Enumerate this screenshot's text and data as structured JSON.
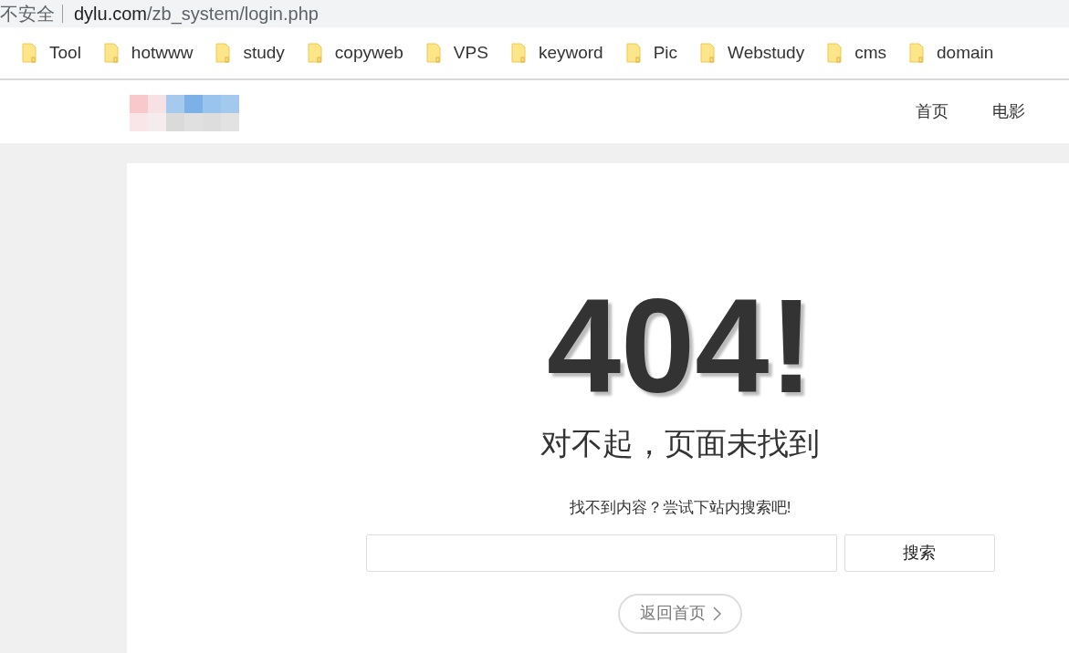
{
  "address_bar": {
    "security": "不安全",
    "url_host": "dylu.com",
    "url_path": "/zb_system/login.php"
  },
  "bookmarks": [
    {
      "label": "Tool"
    },
    {
      "label": "hotwww"
    },
    {
      "label": "study"
    },
    {
      "label": "copyweb"
    },
    {
      "label": "VPS"
    },
    {
      "label": "keyword"
    },
    {
      "label": "Pic"
    },
    {
      "label": "Webstudy"
    },
    {
      "label": "cms"
    },
    {
      "label": "domain"
    }
  ],
  "site_header": {
    "nav": [
      "首页",
      "电影"
    ]
  },
  "error": {
    "code": "404!",
    "title": "对不起，页面未找到",
    "hint": "找不到内容？尝试下站内搜索吧!",
    "search_button": "搜索",
    "back_button": "返回首页"
  }
}
